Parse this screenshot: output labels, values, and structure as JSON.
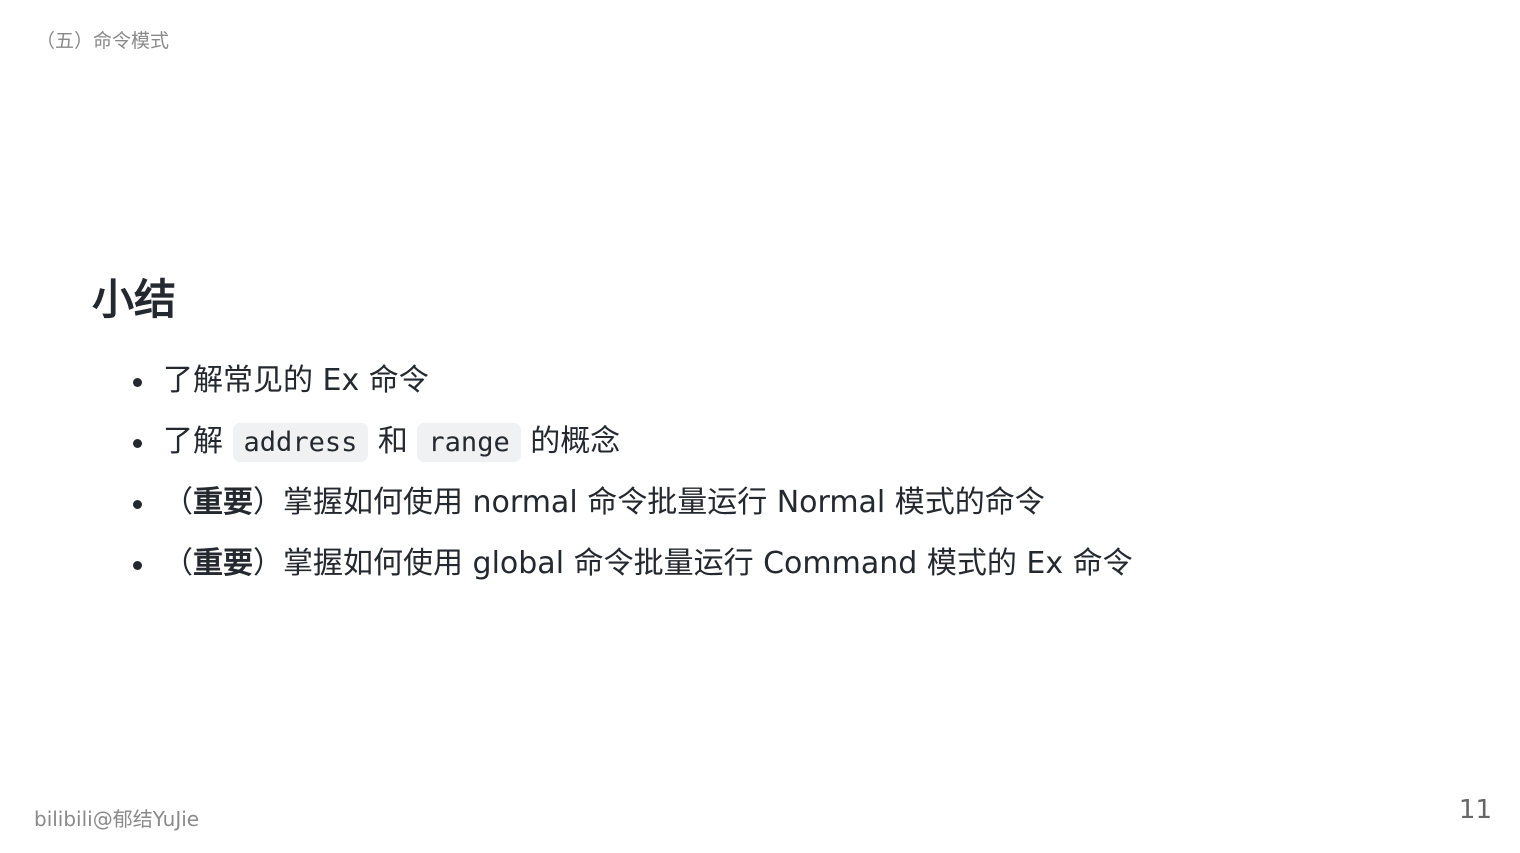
{
  "header": {
    "section": "（五）命令模式"
  },
  "slide": {
    "title": "小结",
    "items": [
      {
        "text": "了解常见的 Ex 命令"
      },
      {
        "pre": "了解 ",
        "code1": "address",
        "mid": " 和 ",
        "code2": "range",
        "post": " 的概念"
      },
      {
        "open": "（",
        "bold": "重要",
        "close": "）",
        "text": "掌握如何使用 normal 命令批量运行 Normal 模式的命令"
      },
      {
        "open": "（",
        "bold": "重要",
        "close": "）",
        "text": "掌握如何使用 global 命令批量运行 Command 模式的 Ex 命令"
      }
    ]
  },
  "footer": {
    "author": "bilibili@郁结YuJie",
    "page_number": "11"
  }
}
